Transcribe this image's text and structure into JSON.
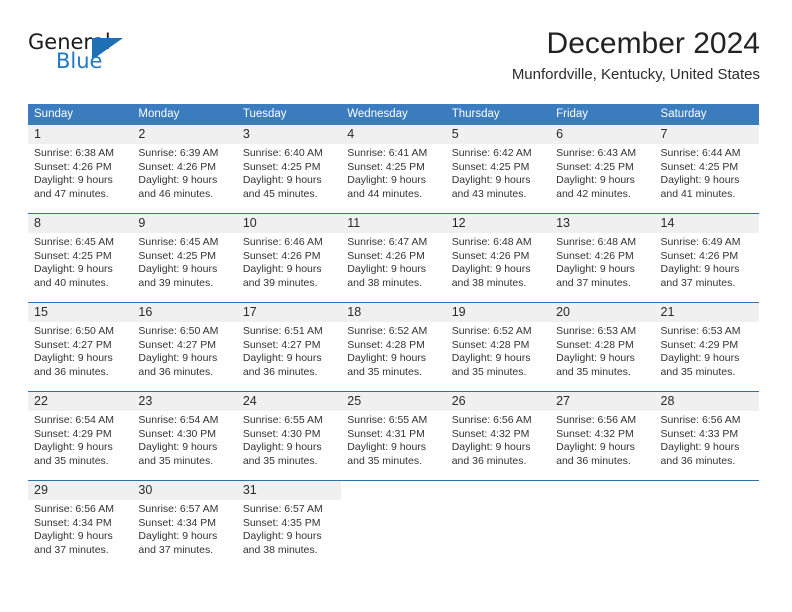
{
  "brand": {
    "name_part1": "General",
    "name_part2": "Blue",
    "logo_icon": "triangle-logo-icon",
    "accent_color": "#1f6fb5"
  },
  "header": {
    "month_title": "December 2024",
    "location": "Munfordville, Kentucky, United States"
  },
  "theme": {
    "header_blue": "#3a7cbd",
    "week_divider": "#2f6fac",
    "day_band_gray": "#f0f0f0"
  },
  "calendar": {
    "weekday_headers": [
      "Sunday",
      "Monday",
      "Tuesday",
      "Wednesday",
      "Thursday",
      "Friday",
      "Saturday"
    ],
    "weeks": [
      [
        {
          "day": "1",
          "sunrise": "Sunrise: 6:38 AM",
          "sunset": "Sunset: 4:26 PM",
          "daylight_line1": "Daylight: 9 hours",
          "daylight_line2": "and 47 minutes."
        },
        {
          "day": "2",
          "sunrise": "Sunrise: 6:39 AM",
          "sunset": "Sunset: 4:26 PM",
          "daylight_line1": "Daylight: 9 hours",
          "daylight_line2": "and 46 minutes."
        },
        {
          "day": "3",
          "sunrise": "Sunrise: 6:40 AM",
          "sunset": "Sunset: 4:25 PM",
          "daylight_line1": "Daylight: 9 hours",
          "daylight_line2": "and 45 minutes."
        },
        {
          "day": "4",
          "sunrise": "Sunrise: 6:41 AM",
          "sunset": "Sunset: 4:25 PM",
          "daylight_line1": "Daylight: 9 hours",
          "daylight_line2": "and 44 minutes."
        },
        {
          "day": "5",
          "sunrise": "Sunrise: 6:42 AM",
          "sunset": "Sunset: 4:25 PM",
          "daylight_line1": "Daylight: 9 hours",
          "daylight_line2": "and 43 minutes."
        },
        {
          "day": "6",
          "sunrise": "Sunrise: 6:43 AM",
          "sunset": "Sunset: 4:25 PM",
          "daylight_line1": "Daylight: 9 hours",
          "daylight_line2": "and 42 minutes."
        },
        {
          "day": "7",
          "sunrise": "Sunrise: 6:44 AM",
          "sunset": "Sunset: 4:25 PM",
          "daylight_line1": "Daylight: 9 hours",
          "daylight_line2": "and 41 minutes."
        }
      ],
      [
        {
          "day": "8",
          "sunrise": "Sunrise: 6:45 AM",
          "sunset": "Sunset: 4:25 PM",
          "daylight_line1": "Daylight: 9 hours",
          "daylight_line2": "and 40 minutes."
        },
        {
          "day": "9",
          "sunrise": "Sunrise: 6:45 AM",
          "sunset": "Sunset: 4:25 PM",
          "daylight_line1": "Daylight: 9 hours",
          "daylight_line2": "and 39 minutes."
        },
        {
          "day": "10",
          "sunrise": "Sunrise: 6:46 AM",
          "sunset": "Sunset: 4:26 PM",
          "daylight_line1": "Daylight: 9 hours",
          "daylight_line2": "and 39 minutes."
        },
        {
          "day": "11",
          "sunrise": "Sunrise: 6:47 AM",
          "sunset": "Sunset: 4:26 PM",
          "daylight_line1": "Daylight: 9 hours",
          "daylight_line2": "and 38 minutes."
        },
        {
          "day": "12",
          "sunrise": "Sunrise: 6:48 AM",
          "sunset": "Sunset: 4:26 PM",
          "daylight_line1": "Daylight: 9 hours",
          "daylight_line2": "and 38 minutes."
        },
        {
          "day": "13",
          "sunrise": "Sunrise: 6:48 AM",
          "sunset": "Sunset: 4:26 PM",
          "daylight_line1": "Daylight: 9 hours",
          "daylight_line2": "and 37 minutes."
        },
        {
          "day": "14",
          "sunrise": "Sunrise: 6:49 AM",
          "sunset": "Sunset: 4:26 PM",
          "daylight_line1": "Daylight: 9 hours",
          "daylight_line2": "and 37 minutes."
        }
      ],
      [
        {
          "day": "15",
          "sunrise": "Sunrise: 6:50 AM",
          "sunset": "Sunset: 4:27 PM",
          "daylight_line1": "Daylight: 9 hours",
          "daylight_line2": "and 36 minutes."
        },
        {
          "day": "16",
          "sunrise": "Sunrise: 6:50 AM",
          "sunset": "Sunset: 4:27 PM",
          "daylight_line1": "Daylight: 9 hours",
          "daylight_line2": "and 36 minutes."
        },
        {
          "day": "17",
          "sunrise": "Sunrise: 6:51 AM",
          "sunset": "Sunset: 4:27 PM",
          "daylight_line1": "Daylight: 9 hours",
          "daylight_line2": "and 36 minutes."
        },
        {
          "day": "18",
          "sunrise": "Sunrise: 6:52 AM",
          "sunset": "Sunset: 4:28 PM",
          "daylight_line1": "Daylight: 9 hours",
          "daylight_line2": "and 35 minutes."
        },
        {
          "day": "19",
          "sunrise": "Sunrise: 6:52 AM",
          "sunset": "Sunset: 4:28 PM",
          "daylight_line1": "Daylight: 9 hours",
          "daylight_line2": "and 35 minutes."
        },
        {
          "day": "20",
          "sunrise": "Sunrise: 6:53 AM",
          "sunset": "Sunset: 4:28 PM",
          "daylight_line1": "Daylight: 9 hours",
          "daylight_line2": "and 35 minutes."
        },
        {
          "day": "21",
          "sunrise": "Sunrise: 6:53 AM",
          "sunset": "Sunset: 4:29 PM",
          "daylight_line1": "Daylight: 9 hours",
          "daylight_line2": "and 35 minutes."
        }
      ],
      [
        {
          "day": "22",
          "sunrise": "Sunrise: 6:54 AM",
          "sunset": "Sunset: 4:29 PM",
          "daylight_line1": "Daylight: 9 hours",
          "daylight_line2": "and 35 minutes."
        },
        {
          "day": "23",
          "sunrise": "Sunrise: 6:54 AM",
          "sunset": "Sunset: 4:30 PM",
          "daylight_line1": "Daylight: 9 hours",
          "daylight_line2": "and 35 minutes."
        },
        {
          "day": "24",
          "sunrise": "Sunrise: 6:55 AM",
          "sunset": "Sunset: 4:30 PM",
          "daylight_line1": "Daylight: 9 hours",
          "daylight_line2": "and 35 minutes."
        },
        {
          "day": "25",
          "sunrise": "Sunrise: 6:55 AM",
          "sunset": "Sunset: 4:31 PM",
          "daylight_line1": "Daylight: 9 hours",
          "daylight_line2": "and 35 minutes."
        },
        {
          "day": "26",
          "sunrise": "Sunrise: 6:56 AM",
          "sunset": "Sunset: 4:32 PM",
          "daylight_line1": "Daylight: 9 hours",
          "daylight_line2": "and 36 minutes."
        },
        {
          "day": "27",
          "sunrise": "Sunrise: 6:56 AM",
          "sunset": "Sunset: 4:32 PM",
          "daylight_line1": "Daylight: 9 hours",
          "daylight_line2": "and 36 minutes."
        },
        {
          "day": "28",
          "sunrise": "Sunrise: 6:56 AM",
          "sunset": "Sunset: 4:33 PM",
          "daylight_line1": "Daylight: 9 hours",
          "daylight_line2": "and 36 minutes."
        }
      ],
      [
        {
          "day": "29",
          "sunrise": "Sunrise: 6:56 AM",
          "sunset": "Sunset: 4:34 PM",
          "daylight_line1": "Daylight: 9 hours",
          "daylight_line2": "and 37 minutes."
        },
        {
          "day": "30",
          "sunrise": "Sunrise: 6:57 AM",
          "sunset": "Sunset: 4:34 PM",
          "daylight_line1": "Daylight: 9 hours",
          "daylight_line2": "and 37 minutes."
        },
        {
          "day": "31",
          "sunrise": "Sunrise: 6:57 AM",
          "sunset": "Sunset: 4:35 PM",
          "daylight_line1": "Daylight: 9 hours",
          "daylight_line2": "and 38 minutes."
        },
        {
          "day": "",
          "sunrise": "",
          "sunset": "",
          "daylight_line1": "",
          "daylight_line2": ""
        },
        {
          "day": "",
          "sunrise": "",
          "sunset": "",
          "daylight_line1": "",
          "daylight_line2": ""
        },
        {
          "day": "",
          "sunrise": "",
          "sunset": "",
          "daylight_line1": "",
          "daylight_line2": ""
        },
        {
          "day": "",
          "sunrise": "",
          "sunset": "",
          "daylight_line1": "",
          "daylight_line2": ""
        }
      ]
    ]
  }
}
